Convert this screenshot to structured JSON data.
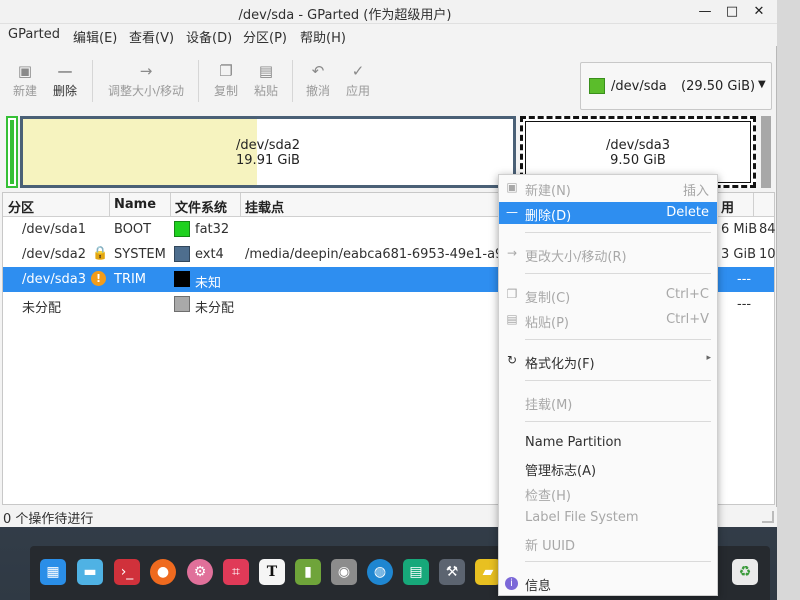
{
  "window": {
    "title": "/dev/sda - GParted (作为超级用户)",
    "controls": {
      "minimize": "—",
      "maximize": "□",
      "close": "✕"
    }
  },
  "menubar": [
    "GParted",
    "编辑(E)",
    "查看(V)",
    "设备(D)",
    "分区(P)",
    "帮助(H)"
  ],
  "toolbar": {
    "new": "新建",
    "delete": "删除",
    "resize": "调整大小/移动",
    "copy": "复制",
    "paste": "粘贴",
    "undo": "撤消",
    "apply": "应用"
  },
  "device_selector": {
    "device": "/dev/sda",
    "size": "(29.50 GiB)"
  },
  "partition_map": {
    "sda2": {
      "name": "/dev/sda2",
      "size": "19.91 GiB"
    },
    "sda3": {
      "name": "/dev/sda3",
      "size": "9.50 GiB"
    }
  },
  "table": {
    "headers": [
      "分区",
      "Name",
      "文件系统",
      "挂载点",
      "用"
    ],
    "rows": [
      {
        "partition": "/dev/sda1",
        "name": "BOOT",
        "fs": "fat32",
        "fs_color": "#1fd11f",
        "mount": "",
        "col_used": "6 MiB",
        "col_last": "84"
      },
      {
        "partition": "/dev/sda2",
        "name": "SYSTEM",
        "fs": "ext4",
        "fs_color": "#4e6e8e",
        "mount": "/media/deepin/eabca681-6953-49e1-a9",
        "col_used": "3 GiB",
        "col_last": "10"
      },
      {
        "partition": "/dev/sda3",
        "name": "TRIM",
        "fs": "未知",
        "fs_color": "#000000",
        "mount": "",
        "col_used": "---",
        "col_last": ""
      },
      {
        "partition": "未分配",
        "name": "",
        "fs": "未分配",
        "fs_color": "#a9a9a9",
        "mount": "",
        "col_used": "---",
        "col_last": ""
      }
    ]
  },
  "status": {
    "text": "0 个操作待进行"
  },
  "context_menu": {
    "new": {
      "label": "新建(N)",
      "shortcut": "插入"
    },
    "delete": {
      "label": "删除(D)",
      "shortcut": "Delete"
    },
    "resize": {
      "label": "更改大小/移动(R)"
    },
    "copy": {
      "label": "复制(C)",
      "shortcut": "Ctrl+C"
    },
    "paste": {
      "label": "粘贴(P)",
      "shortcut": "Ctrl+V"
    },
    "format": {
      "label": "格式化为(F)"
    },
    "mount": {
      "label": "挂载(M)"
    },
    "name_partition": {
      "label": "Name Partition"
    },
    "manage_flags": {
      "label": "管理标志(A)"
    },
    "check": {
      "label": "检查(H)"
    },
    "label_fs": {
      "label": "Label File System"
    },
    "new_uuid": {
      "label": "新 UUID"
    },
    "info": {
      "label": "信息"
    }
  },
  "dock": {
    "icons": [
      "launcher-icon",
      "file-manager-icon",
      "terminal-icon",
      "firefox-icon",
      "settings-icon",
      "screenshot-icon",
      "text-editor-icon",
      "archive-icon",
      "disk-utility-icon",
      "store-icon",
      "monitor-icon",
      "tools-icon",
      "usb-icon",
      "trash-icon"
    ]
  }
}
